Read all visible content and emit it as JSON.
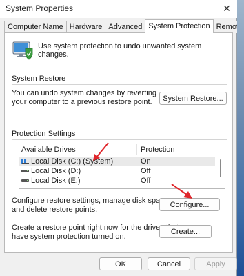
{
  "window": {
    "title": "System Properties",
    "close_glyph": "✕"
  },
  "tabs": [
    {
      "label": "Computer Name",
      "active": false
    },
    {
      "label": "Hardware",
      "active": false
    },
    {
      "label": "Advanced",
      "active": false
    },
    {
      "label": "System Protection",
      "active": true
    },
    {
      "label": "Remote",
      "active": false
    }
  ],
  "intro": {
    "text": "Use system protection to undo unwanted system changes.",
    "icon": "system-protection-shield-monitor-icon"
  },
  "system_restore": {
    "title": "System Restore",
    "description_line1": "You can undo system changes by reverting",
    "description_line2": "your computer to a previous restore point.",
    "button_label": "System Restore..."
  },
  "protection_settings": {
    "title": "Protection Settings",
    "columns": [
      "Available Drives",
      "Protection"
    ],
    "drives": [
      {
        "name": "Local Disk (C:) (System)",
        "protection": "On",
        "icon": "system-drive-icon",
        "selected": true
      },
      {
        "name": "Local Disk (D:)",
        "protection": "Off",
        "icon": "drive-icon",
        "selected": false
      },
      {
        "name": "Local Disk (E:)",
        "protection": "Off",
        "icon": "drive-icon",
        "selected": false
      }
    ],
    "configure_text_line1": "Configure restore settings, manage disk space,",
    "configure_text_line2": "and delete restore points.",
    "configure_button": "Configure...",
    "create_text_line1": "Create a restore point right now for the drives that",
    "create_text_line2": "have system protection turned on.",
    "create_button": "Create..."
  },
  "footer": {
    "ok": "OK",
    "cancel": "Cancel",
    "apply": "Apply"
  },
  "colors": {
    "annotation_arrow": "#e0262b",
    "window_bg": "#f0f0f0",
    "panel_bg": "#ffffff"
  }
}
